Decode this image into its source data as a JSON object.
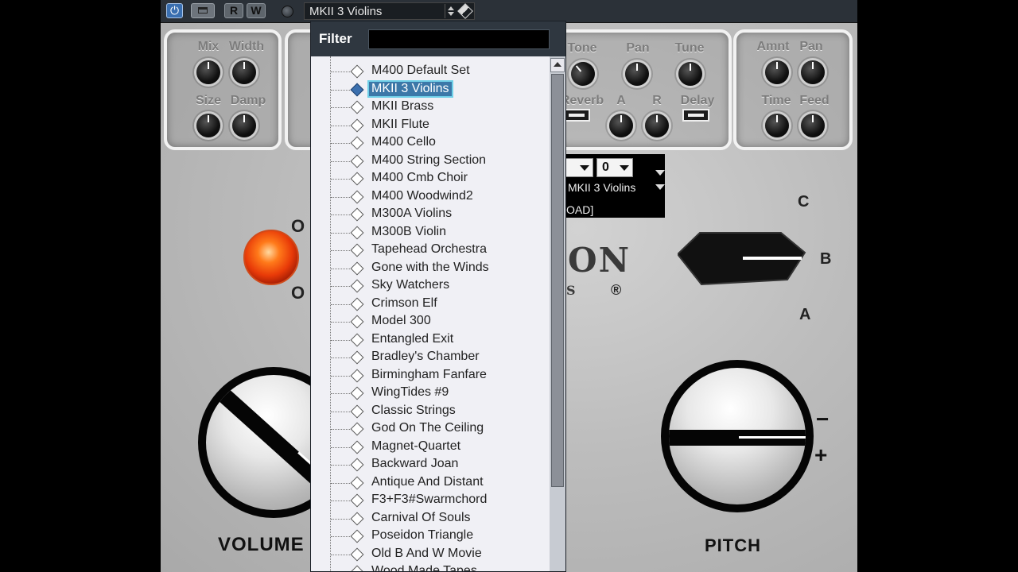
{
  "titlebar": {
    "read_label": "R",
    "write_label": "W",
    "power_glyph": "⏻",
    "preset_name": "MKII 3 Violins"
  },
  "reverb_panel": {
    "knobs": [
      "Mix",
      "Width",
      "Size",
      "Damp"
    ]
  },
  "tone_panel": {
    "labels": {
      "tone": "Tone",
      "pan": "Pan",
      "tune": "Tune",
      "reverb": "Reverb",
      "a": "A",
      "r": "R",
      "delay": "Delay"
    }
  },
  "delay_panel": {
    "labels": [
      "Amnt",
      "Pan",
      "Time",
      "Feed"
    ]
  },
  "info_panel": {
    "octave_value": "0",
    "sound_name": "MKII 3 Violins",
    "load_text": "OAD]"
  },
  "logo": {
    "partial_text": "ON",
    "registered": "®",
    "partial_small": "S"
  },
  "switch_labels": {
    "top": "O",
    "bottom": "O"
  },
  "selector_labels": {
    "c": "C",
    "b": "B",
    "a": "A"
  },
  "volume_label": "VOLUME",
  "pitch_label": "PITCH",
  "pitch_marks": {
    "minus": "−",
    "plus": "+"
  },
  "dropdown": {
    "filter_label": "Filter",
    "filter_value": "",
    "selected_index": 1,
    "items": [
      "M400 Default Set",
      "MKII 3 Violins",
      "MKII Brass",
      "MKII Flute",
      "M400 Cello",
      "M400 String Section",
      "M400 Cmb Choir",
      "M400 Woodwind2",
      "M300A Violins",
      "M300B Violin",
      "Tapehead Orchestra",
      "Gone with the Winds",
      "Sky Watchers",
      "Crimson Elf",
      "Model 300",
      "Entangled Exit",
      "Bradley's Chamber",
      "Birmingham Fanfare",
      "WingTides #9",
      "Classic Strings",
      "God On The Ceiling",
      "Magnet-Quartet",
      "Backward Joan",
      "Antique And Distant",
      "F3+F3#Swarmchord",
      "Carnival Of Souls",
      "Poseidon Triangle",
      "Old B And W Movie",
      "Wood Made Tapes"
    ]
  }
}
